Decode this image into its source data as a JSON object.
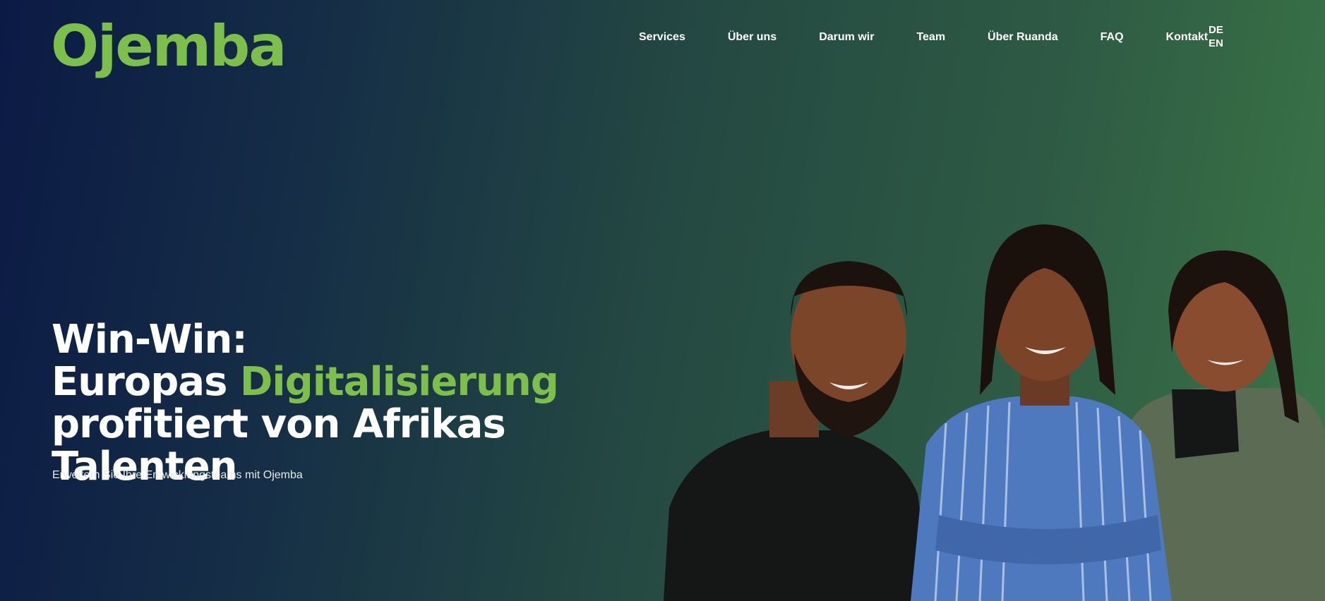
{
  "brand": {
    "logo_text": "Ojemba",
    "accent_color": "#7cc04b"
  },
  "nav": {
    "items": [
      {
        "label": "Services"
      },
      {
        "label": "Über uns"
      },
      {
        "label": "Darum wir"
      },
      {
        "label": "Team"
      },
      {
        "label": "Über Ruanda"
      },
      {
        "label": "FAQ"
      },
      {
        "label": "Kontakt"
      }
    ],
    "languages": [
      "DE",
      "EN"
    ]
  },
  "hero": {
    "title_line1": "Win-Win:",
    "title_line2_prefix": "Europas ",
    "title_line2_accent": "Digitalisierung",
    "title_line3": "profitiert von Afrikas Talenten",
    "subtitle": "Erweitern Sie Ihre Entwicklungsteams mit Ojemba"
  }
}
